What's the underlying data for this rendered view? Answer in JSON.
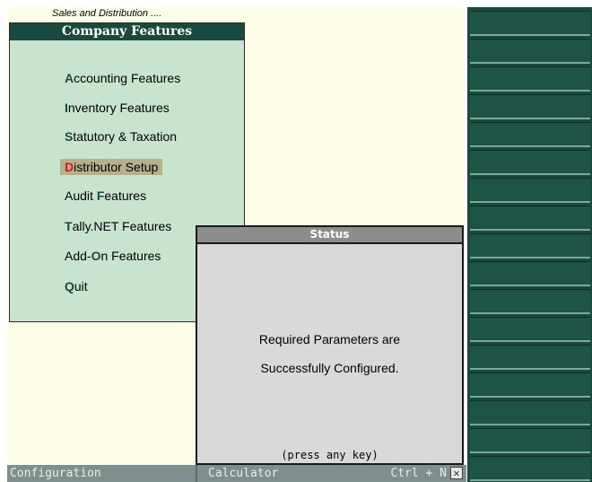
{
  "header": {
    "subtitle": "Sales and Distribution ...."
  },
  "menu": {
    "title": "Company Features",
    "items": [
      {
        "pre": "",
        "hot": "A",
        "post": "ccounting Features",
        "selected": false
      },
      {
        "pre": "",
        "hot": "I",
        "post": "nventory Features",
        "selected": false
      },
      {
        "pre": "",
        "hot": "S",
        "post": "tatutory & Taxation",
        "selected": false
      },
      {
        "pre": "",
        "hot": "D",
        "post": "istributor Setup",
        "selected": true
      },
      {
        "pre": "Audit ",
        "hot": "F",
        "post": "eatures",
        "selected": false
      },
      {
        "pre": "",
        "hot": "T",
        "post": "ally.NET Features",
        "selected": false
      },
      {
        "pre": "Add-",
        "hot": "O",
        "post": "n Features",
        "selected": false
      },
      {
        "pre": "",
        "hot": "Q",
        "post": "uit",
        "selected": false
      }
    ]
  },
  "status": {
    "title": "Status",
    "line1": "Required Parameters are",
    "line2": "Successfully Configured.",
    "footer": "(press any key)"
  },
  "bottom_bar": {
    "left": "Configuration",
    "calculator": "Calculator",
    "shortcut": "Ctrl + N",
    "close_glyph": "✕"
  },
  "colors": {
    "panel_bg": "#fefee6",
    "menu_bg": "#c8e4ce",
    "title_bg": "#1a4a3f",
    "status_bg": "#d9d9d9",
    "hotkey_selected": "#d61a1a"
  }
}
